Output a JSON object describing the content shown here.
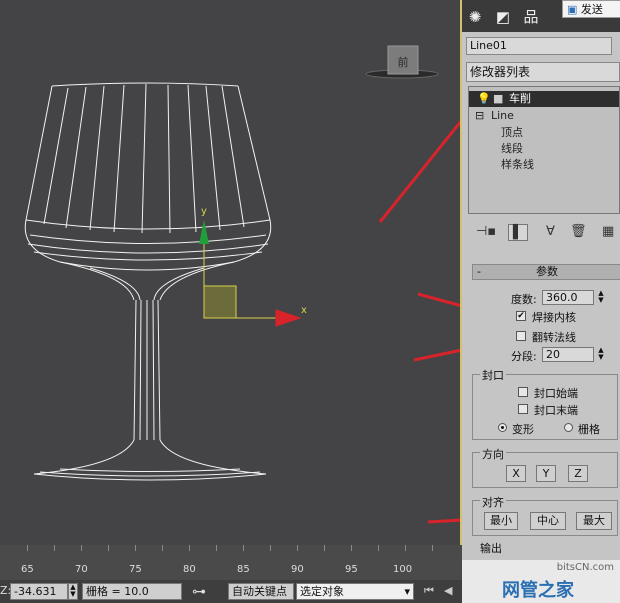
{
  "viewport": {
    "view_cube_label": "前",
    "axis_y": "y",
    "axis_x": "x"
  },
  "panel": {
    "tabs": [
      "create-icon",
      "modify-icon",
      "hierarchy-icon",
      "motion-icon",
      "display-icon"
    ],
    "send_button": "发送",
    "object_name": "Line01",
    "modifier_list": "修改器列表",
    "stack": {
      "selected": "车削",
      "base": "Line",
      "sub": [
        "顶点",
        "线段",
        "样条线"
      ]
    },
    "params": {
      "title": "参数",
      "degrees_label": "度数:",
      "degrees_value": "360.0",
      "weld_core": "焊接内核",
      "weld_core_checked": true,
      "flip_normals": "翻转法线",
      "flip_normals_checked": false,
      "segments_label": "分段:",
      "segments_value": "20"
    },
    "capping": {
      "title": "封口",
      "cap_start": "封口始端",
      "cap_end": "封口末端",
      "morph": "变形",
      "grid": "栅格"
    },
    "direction": {
      "title": "方向",
      "x": "X",
      "y": "Y",
      "z": "Z"
    },
    "align": {
      "title": "对齐",
      "min": "最小",
      "center": "中心",
      "max": "最大"
    },
    "output": {
      "title": "输出"
    }
  },
  "timeline": {
    "ticks": [
      "65",
      "70",
      "75",
      "80",
      "85",
      "90",
      "95",
      "100"
    ]
  },
  "status": {
    "z_label": "Z:",
    "z_value": "-34.631",
    "grid": "栅格 = 10.0",
    "auto_key": "自动关键点",
    "selection": "选定对象"
  },
  "watermark": {
    "site": "bitsCN.com",
    "name": "网管之家"
  },
  "colors": {
    "selection_bg": "#2e2e2e",
    "annotation_arrow": "#d8232a",
    "axis_y": "#1f9e3a",
    "axis_x": "#c8202a",
    "gizmo": "#6b6b3c",
    "viewport_border": "#d7c06a"
  }
}
